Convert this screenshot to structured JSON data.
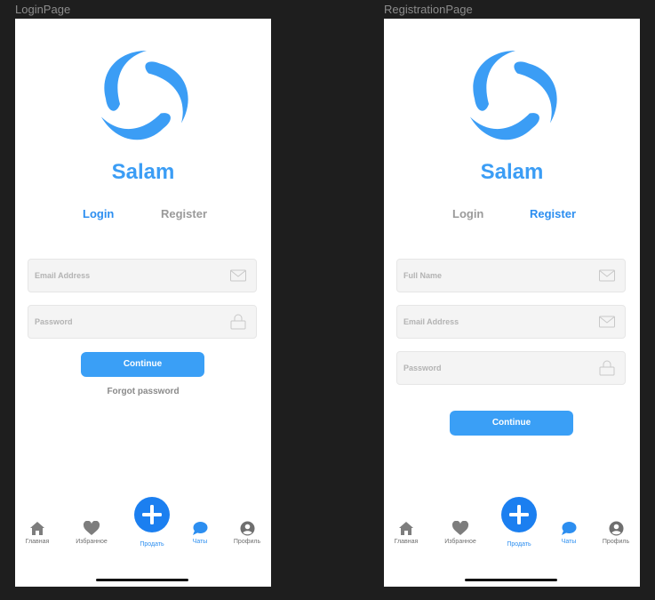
{
  "colors": {
    "accent": "#3b9df5",
    "sell": "#1b7ff0",
    "bg": "#1e1e1e"
  },
  "login_page": {
    "frame_title": "LoginPage",
    "app_name": "Salam",
    "tabs": {
      "login": "Login",
      "register": "Register",
      "active": "login"
    },
    "email": {
      "placeholder": "Email Address",
      "icon": "envelope-icon"
    },
    "password": {
      "placeholder": "Password",
      "icon": "lock-icon"
    },
    "continue_label": "Continue",
    "forgot_label": "Forgot password"
  },
  "registration_page": {
    "frame_title": "RegistrationPage",
    "app_name": "Salam",
    "tabs": {
      "login": "Login",
      "register": "Register",
      "active": "register"
    },
    "full_name": {
      "placeholder": "Full Name",
      "icon": "envelope-icon"
    },
    "email": {
      "placeholder": "Email Address",
      "icon": "envelope-icon"
    },
    "password": {
      "placeholder": "Password",
      "icon": "lock-icon"
    },
    "continue_label": "Continue"
  },
  "bottom_nav": {
    "home": {
      "label": "Главная",
      "icon": "home-icon"
    },
    "favorites": {
      "label": "Избранное",
      "icon": "heart-icon"
    },
    "sell": {
      "label": "Продать",
      "icon": "plus-icon"
    },
    "chats": {
      "label": "Чаты",
      "icon": "chat-bubble-icon",
      "active": true
    },
    "profile": {
      "label": "Профиль",
      "icon": "profile-icon"
    }
  }
}
